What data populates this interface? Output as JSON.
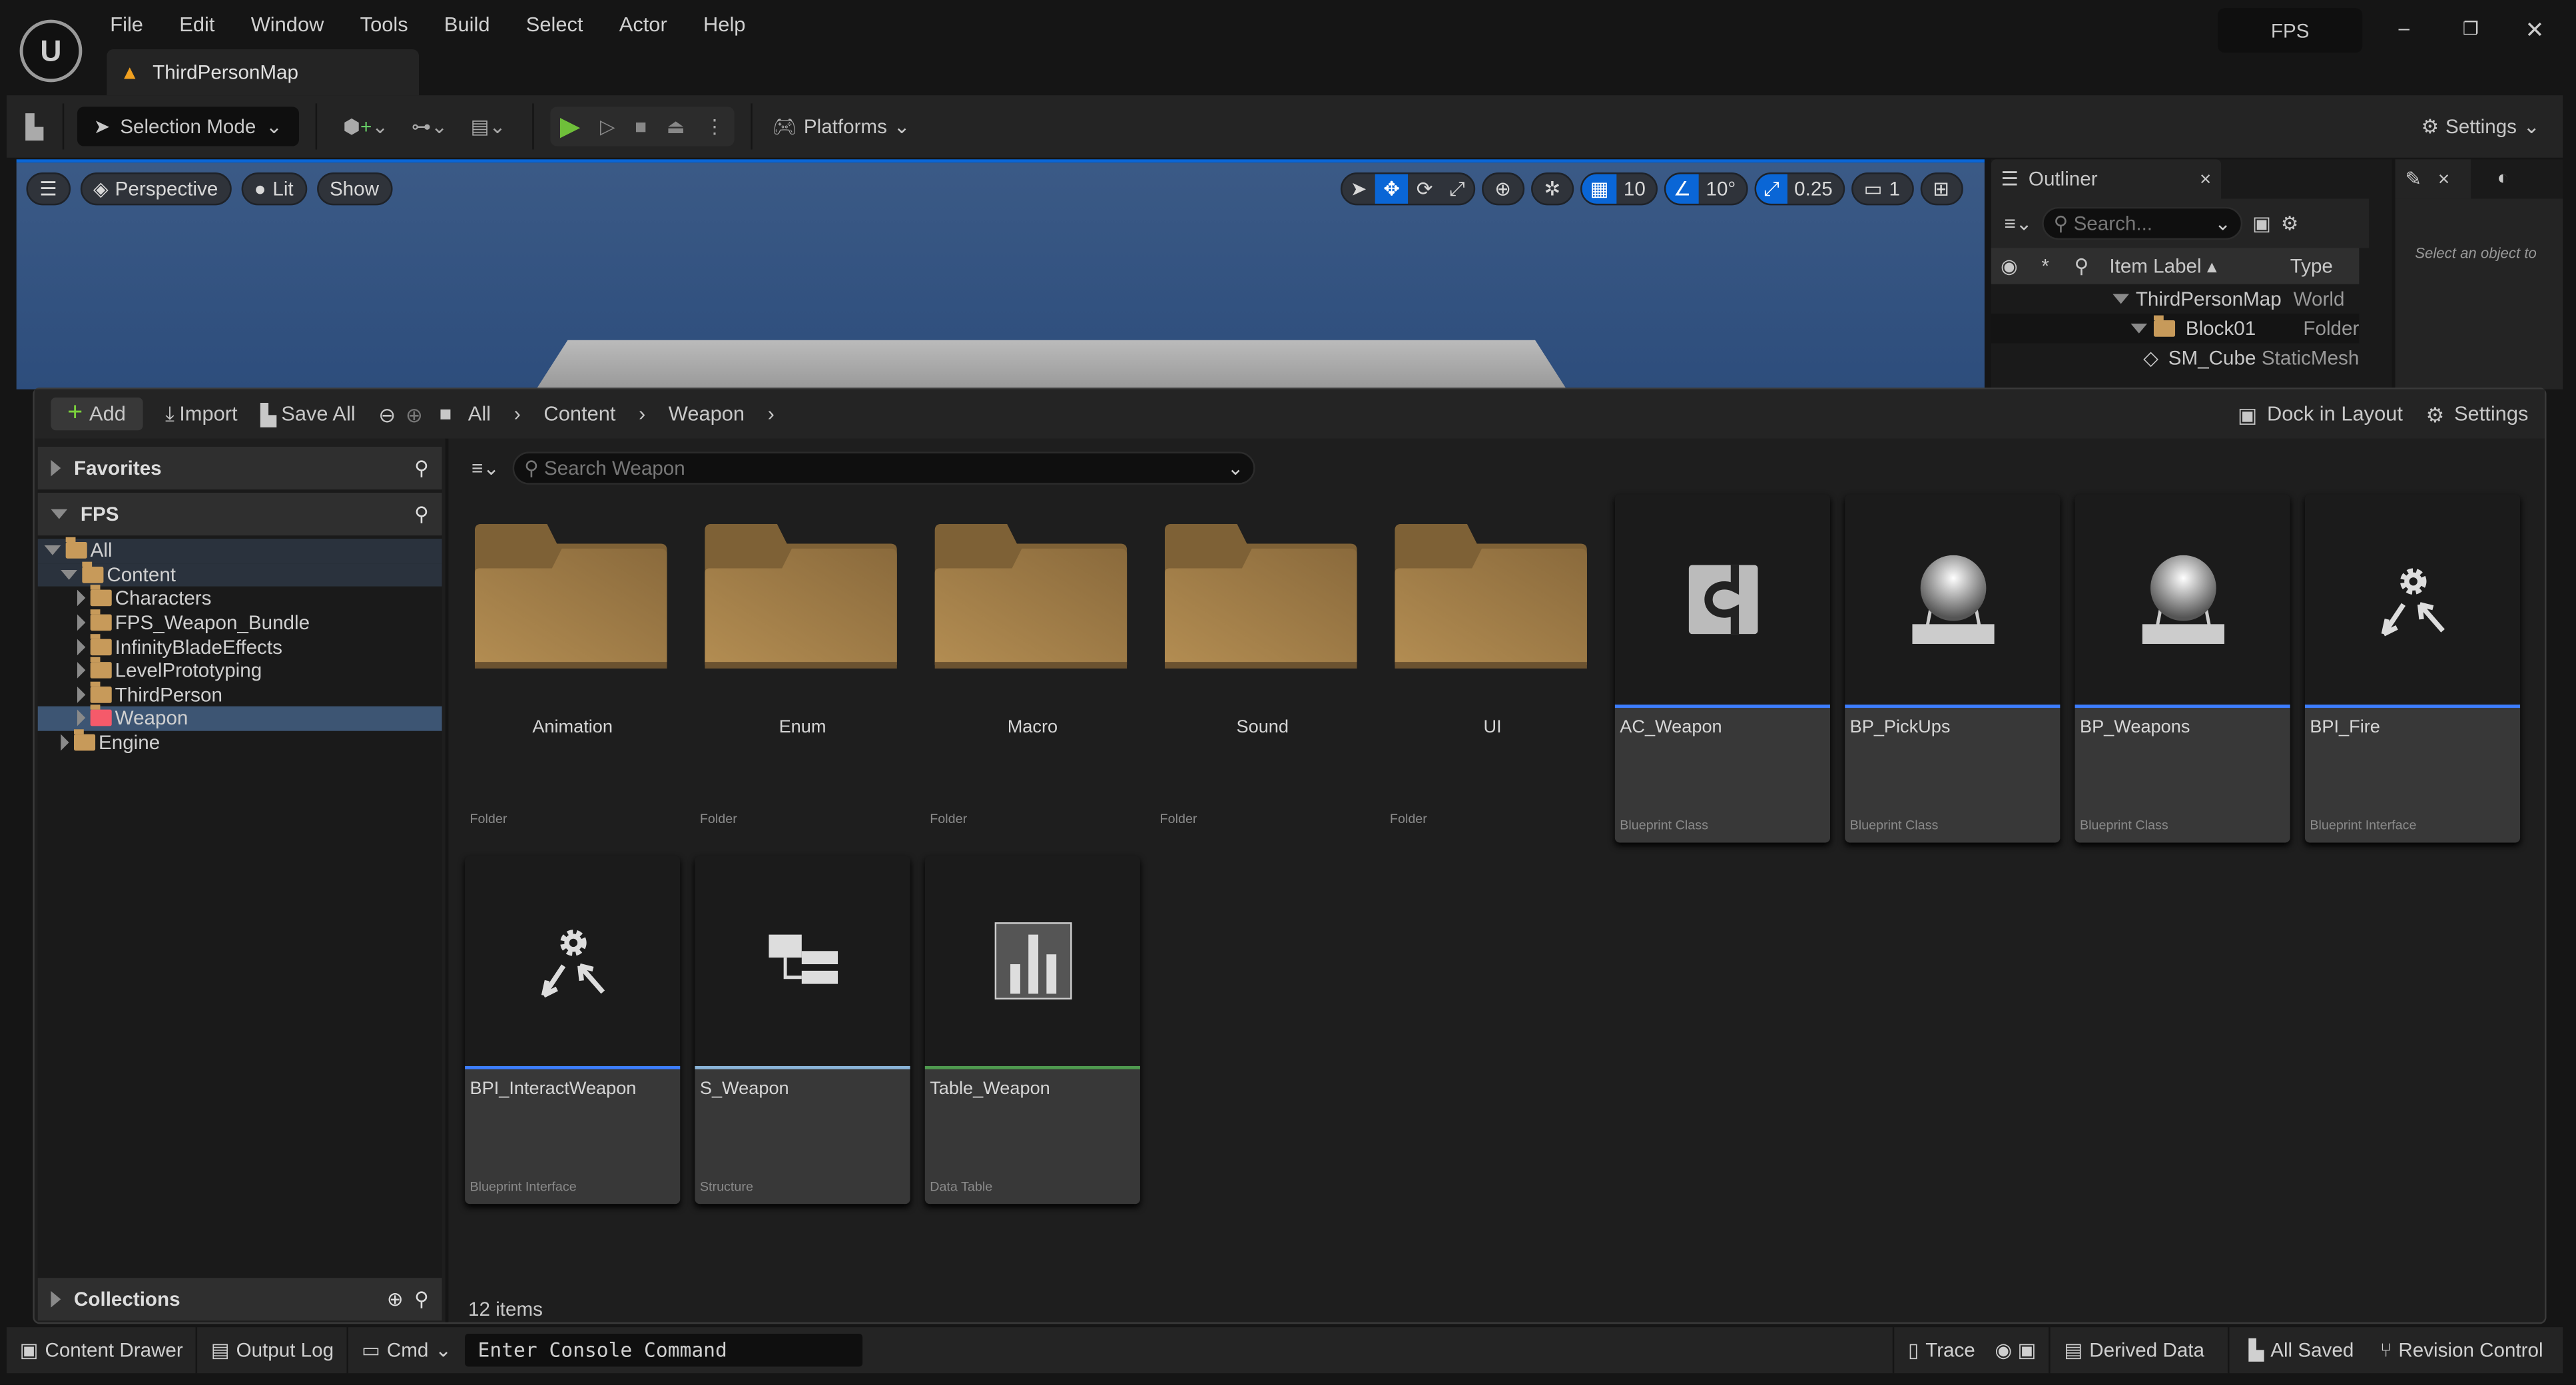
{
  "app": {
    "menu": [
      "File",
      "Edit",
      "Window",
      "Tools",
      "Build",
      "Select",
      "Actor",
      "Help"
    ],
    "project": "FPS",
    "map_tab": "ThirdPersonMap"
  },
  "toolbar": {
    "selection_mode": "Selection Mode",
    "platforms": "Platforms",
    "settings": "Settings"
  },
  "viewport": {
    "perspective": "Perspective",
    "lit": "Lit",
    "show": "Show",
    "grid_snap": "10",
    "rot_snap": "10°",
    "scale_snap": "0.25",
    "camera_speed": "1"
  },
  "outliner": {
    "title": "Outliner",
    "search_placeholder": "Search...",
    "col_label": "Item Label",
    "col_type": "Type",
    "rows": [
      {
        "label": "ThirdPersonMap",
        "type": "World"
      },
      {
        "label": "Block01",
        "type": "Folder"
      },
      {
        "label": "SM_Cube",
        "type": "StaticMesh"
      }
    ]
  },
  "details": {
    "hint": "Select an object to"
  },
  "drawer": {
    "add": "Add",
    "import": "Import",
    "save_all": "Save All",
    "breadcrumb": [
      "All",
      "Content",
      "Weapon"
    ],
    "dock": "Dock in Layout",
    "settings": "Settings",
    "favorites": "Favorites",
    "project": "FPS",
    "collections": "Collections",
    "search_placeholder": "Search Weapon",
    "item_count": "12 items",
    "tree": [
      {
        "label": "All",
        "level": 0
      },
      {
        "label": "Content",
        "level": 1
      },
      {
        "label": "Characters",
        "level": 2
      },
      {
        "label": "FPS_Weapon_Bundle",
        "level": 2
      },
      {
        "label": "InfinityBladeEffects",
        "level": 2
      },
      {
        "label": "LevelPrototyping",
        "level": 2
      },
      {
        "label": "ThirdPerson",
        "level": 2
      },
      {
        "label": "Weapon",
        "level": 2
      },
      {
        "label": "Engine",
        "level": 1
      }
    ],
    "assets": [
      {
        "name": "Animation",
        "type": "Folder",
        "kind": "folder"
      },
      {
        "name": "Enum",
        "type": "Folder",
        "kind": "folder"
      },
      {
        "name": "Macro",
        "type": "Folder",
        "kind": "folder"
      },
      {
        "name": "Sound",
        "type": "Folder",
        "kind": "folder"
      },
      {
        "name": "UI",
        "type": "Folder",
        "kind": "folder"
      },
      {
        "name": "AC_Weapon",
        "type": "Blueprint Class",
        "kind": "component",
        "color": "#3d7eff"
      },
      {
        "name": "BP_PickUps",
        "type": "Blueprint Class",
        "kind": "sphere",
        "color": "#3d7eff"
      },
      {
        "name": "BP_Weapons",
        "type": "Blueprint Class",
        "kind": "sphere",
        "color": "#3d7eff"
      },
      {
        "name": "BPI_Fire",
        "type": "Blueprint Interface",
        "kind": "interface",
        "color": "#3d7eff"
      },
      {
        "name": "BPI_InteractWeapon",
        "type": "Blueprint Interface",
        "kind": "interface",
        "color": "#3d7eff"
      },
      {
        "name": "S_Weapon",
        "type": "Structure",
        "kind": "struct",
        "color": "#8ab4d8"
      },
      {
        "name": "Table_Weapon",
        "type": "Data Table",
        "kind": "table",
        "color": "#4f9a4f"
      }
    ]
  },
  "statusbar": {
    "content_drawer": "Content Drawer",
    "output_log": "Output Log",
    "cmd": "Cmd",
    "console_placeholder": "Enter Console Command",
    "trace": "Trace",
    "derived_data": "Derived Data",
    "all_saved": "All Saved",
    "revision_control": "Revision Control"
  }
}
